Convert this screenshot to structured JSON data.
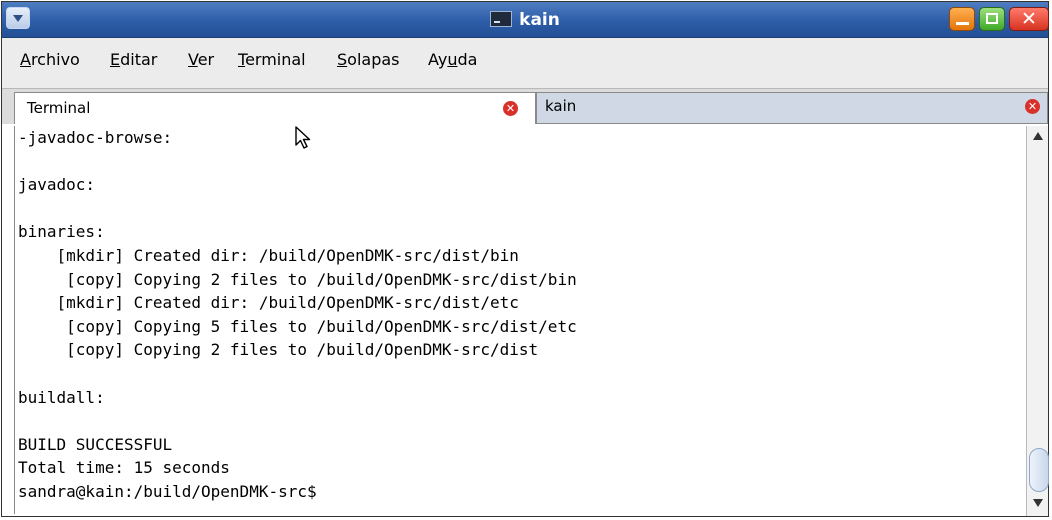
{
  "window": {
    "title": "kain",
    "title_icon": "terminal-icon",
    "colors": {
      "titlebar": "#2d5da8",
      "minimize": "#e37409",
      "maximize": "#3fa82a",
      "close": "#d73322"
    }
  },
  "menubar": {
    "items": [
      {
        "label": "Archivo",
        "mnemonic_index": 0
      },
      {
        "label": "Editar",
        "mnemonic_index": 0
      },
      {
        "label": "Ver",
        "mnemonic_index": 0
      },
      {
        "label": "Terminal",
        "mnemonic_index": 0
      },
      {
        "label": "Solapas",
        "mnemonic_index": 0
      },
      {
        "label": "Ayuda",
        "mnemonic_index": 2
      }
    ]
  },
  "tabs": [
    {
      "label": "Terminal",
      "close_icon": "close-circle-icon",
      "active": true
    },
    {
      "label": "kain",
      "close_icon": "close-circle-icon",
      "active": false
    }
  ],
  "terminal": {
    "lines": [
      "-javadoc-browse:",
      "",
      "javadoc:",
      "",
      "binaries:",
      "    [mkdir] Created dir: /build/OpenDMK-src/dist/bin",
      "     [copy] Copying 2 files to /build/OpenDMK-src/dist/bin",
      "    [mkdir] Created dir: /build/OpenDMK-src/dist/etc",
      "     [copy] Copying 5 files to /build/OpenDMK-src/dist/etc",
      "     [copy] Copying 2 files to /build/OpenDMK-src/dist",
      "",
      "buildall:",
      "",
      "BUILD SUCCESSFUL",
      "Total time: 15 seconds",
      "sandra@kain:/build/OpenDMK-src$"
    ]
  }
}
